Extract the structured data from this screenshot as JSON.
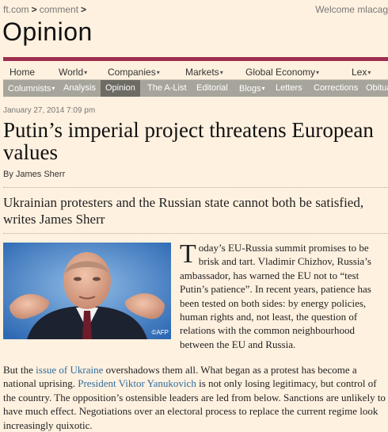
{
  "header": {
    "breadcrumb": [
      "ft.com",
      "comment"
    ],
    "welcome_text": "Welcome mlacag",
    "section_title": "Opinion"
  },
  "nav_primary": [
    {
      "label": "Home",
      "dropdown": false
    },
    {
      "label": "World",
      "dropdown": true
    },
    {
      "label": "Companies",
      "dropdown": true
    },
    {
      "label": "Markets",
      "dropdown": true
    },
    {
      "label": "Global Economy",
      "dropdown": true
    },
    {
      "label": "Lex",
      "dropdown": true
    }
  ],
  "nav_secondary": [
    {
      "label": "Columnists",
      "dropdown": true
    },
    {
      "label": "Analysis",
      "dropdown": false
    },
    {
      "label": "Opinion",
      "dropdown": false,
      "active": true
    },
    {
      "label": "The A-List",
      "dropdown": false
    },
    {
      "label": "Editorial",
      "dropdown": false
    },
    {
      "label": "Blogs",
      "dropdown": true
    },
    {
      "label": "Letters",
      "dropdown": false
    },
    {
      "label": "Corrections",
      "dropdown": false
    },
    {
      "label": "Obituaries",
      "dropdown": false
    }
  ],
  "article": {
    "dateline": "January 27, 2014 7:09 pm",
    "headline": "Putin’s imperial project threatens European values",
    "byline": "By James Sherr",
    "standfirst": "Ukrainian protesters and the Russian state cannot both be satisfied, writes James Sherr",
    "image_credit": "©AFP",
    "intro_dropcap": "T",
    "intro_rest": "oday’s EU-Russia summit promises to be brisk and tart. Vladimir Chizhov, Russia’s ambassador, has warned the EU not to “test Putin’s patience”. In recent years, patience has been tested on both sides: by energy policies, human rights and, not least, the question of relations with the common neighbourhood between the EU and Russia.",
    "para2": {
      "t1": "But the ",
      "link1": "issue of Ukraine",
      "t2": " overshadows them all. What began as a protest has become a national uprising. ",
      "link2": "President Viktor Yanukovich",
      "t3": " is not only losing legitimacy, but control of the country. The opposition’s ostensible leaders are led from below. Sanctions are unlikely to have much effect. Negotiations over an electoral process to replace the current regime look increasingly quixotic."
    }
  },
  "colors": {
    "page_bg": "#fff1e0",
    "accent_bar": "#9e2f50",
    "subnav_bg": "#a7a59b",
    "subnav_active": "#6d6b64",
    "link": "#2e6e9e"
  }
}
